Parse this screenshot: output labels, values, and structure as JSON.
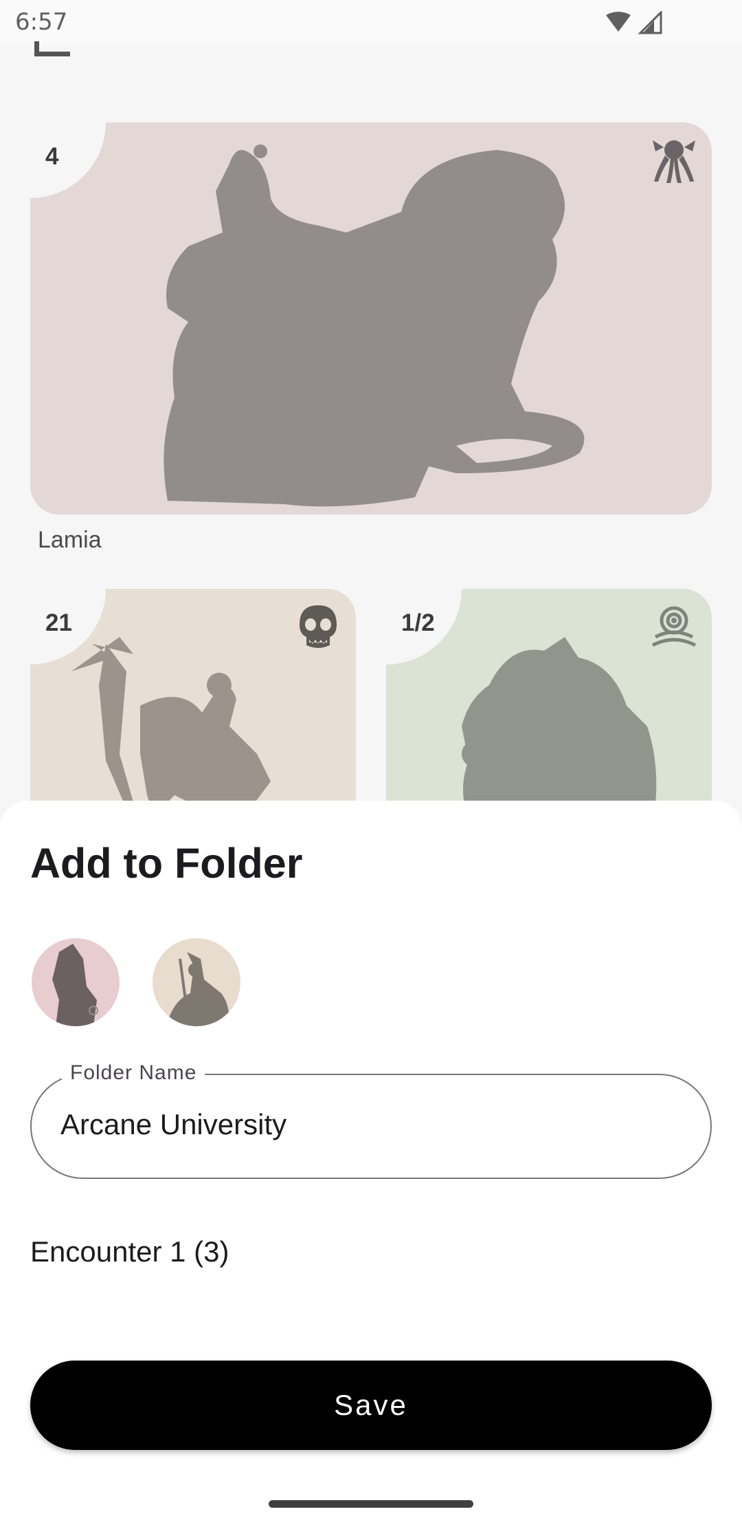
{
  "status_bar": {
    "time": "6:57",
    "icons": [
      "wifi-icon",
      "cell-signal-icon"
    ]
  },
  "cards": [
    {
      "cr": "4",
      "name": "Lamia",
      "type_icon": "aberration-icon",
      "bg": "#e3d8d6"
    },
    {
      "cr": "21",
      "name": "",
      "type_icon": "skull-icon",
      "bg": "#e7dfd4"
    },
    {
      "cr": "1/2",
      "name": "",
      "type_icon": "spiral-eye-icon",
      "bg": "#dbe3d4"
    }
  ],
  "sheet": {
    "title": "Add to Folder",
    "avatars": [
      "folder-monster-avatar-1",
      "folder-monster-avatar-2"
    ],
    "folder_field": {
      "label": "Folder Name",
      "value": "Arcane University"
    },
    "encounter": "Encounter 1 (3)",
    "save_label": "Save"
  },
  "colors": {
    "accent": "#000000",
    "sheet_bg": "#ffffff",
    "page_bg": "#f6f6f6"
  }
}
